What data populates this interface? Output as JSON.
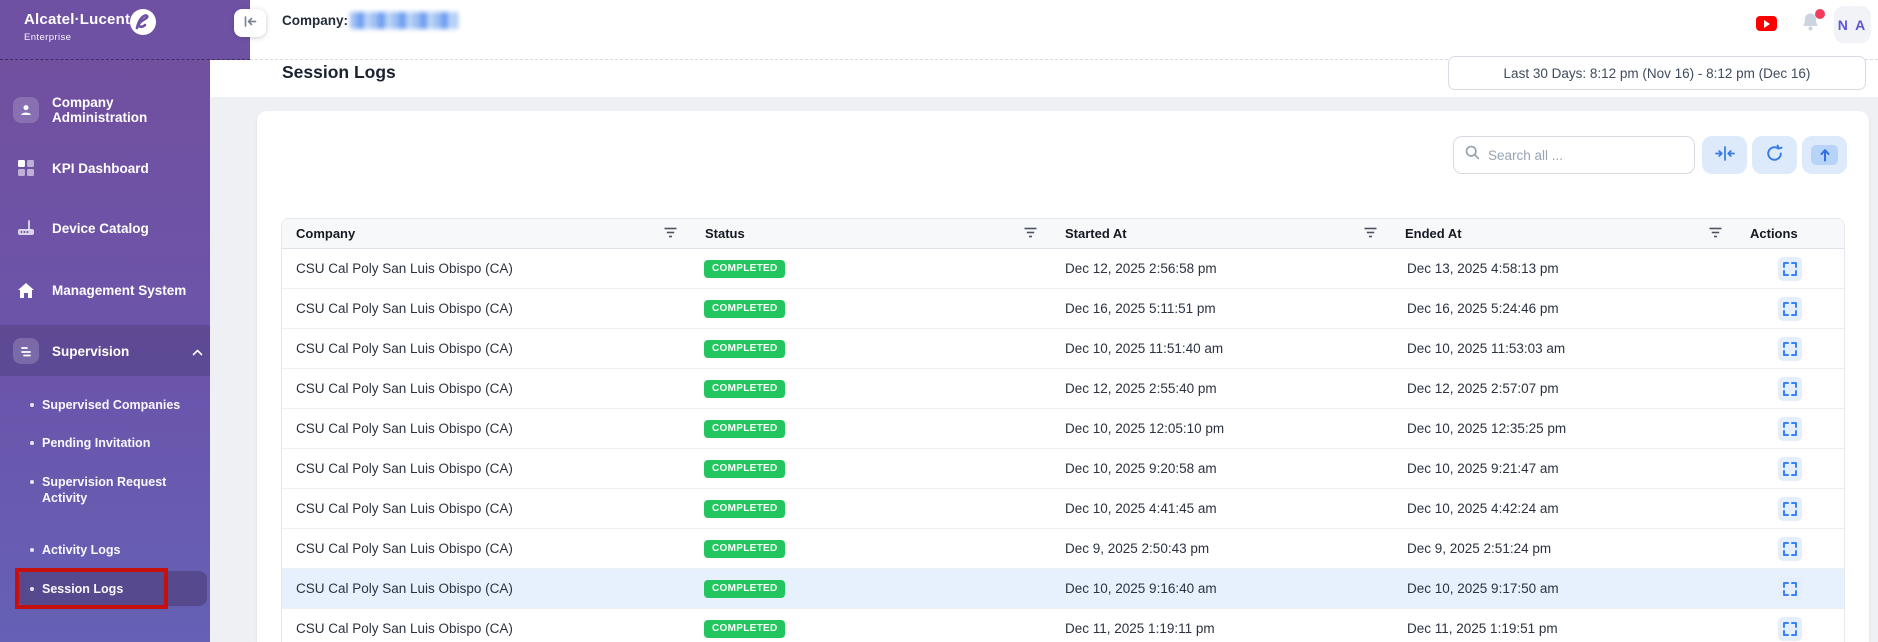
{
  "brand": {
    "name": "Alcatel·Lucent",
    "sub": "Enterprise"
  },
  "topbar": {
    "company_label": "Company:",
    "avatar_initials": "N A"
  },
  "sidebar": {
    "items": [
      {
        "label": "Company Administration",
        "icon": "user-badge-icon"
      },
      {
        "label": "KPI Dashboard",
        "icon": "grid-icon"
      },
      {
        "label": "Device Catalog",
        "icon": "router-icon"
      },
      {
        "label": "Management System",
        "icon": "home-icon"
      },
      {
        "label": "Supervision",
        "icon": "clipboard-list-icon",
        "expanded": true
      }
    ],
    "submenu": [
      "Supervised Companies",
      "Pending Invitation",
      "Supervision Request Activity",
      "Activity Logs",
      "Session Logs"
    ],
    "active_submenu_item": "Session Logs"
  },
  "page": {
    "title": "Session Logs",
    "date_range": "Last 30 Days: 8:12 pm (Nov 16) - 8:12 pm (Dec 16)"
  },
  "toolbar": {
    "search_placeholder": "Search all ..."
  },
  "table": {
    "columns": [
      "Company",
      "Status",
      "Started At",
      "Ended At",
      "Actions"
    ],
    "highlighted_row_index": 8,
    "rows": [
      {
        "company": "CSU Cal Poly San Luis Obispo (CA)",
        "status": "COMPLETED",
        "started_at": "Dec 12, 2025 2:56:58 pm",
        "ended_at": "Dec 13, 2025 4:58:13 pm"
      },
      {
        "company": "CSU Cal Poly San Luis Obispo (CA)",
        "status": "COMPLETED",
        "started_at": "Dec 16, 2025 5:11:51 pm",
        "ended_at": "Dec 16, 2025 5:24:46 pm"
      },
      {
        "company": "CSU Cal Poly San Luis Obispo (CA)",
        "status": "COMPLETED",
        "started_at": "Dec 10, 2025 11:51:40 am",
        "ended_at": "Dec 10, 2025 11:53:03 am"
      },
      {
        "company": "CSU Cal Poly San Luis Obispo (CA)",
        "status": "COMPLETED",
        "started_at": "Dec 12, 2025 2:55:40 pm",
        "ended_at": "Dec 12, 2025 2:57:07 pm"
      },
      {
        "company": "CSU Cal Poly San Luis Obispo (CA)",
        "status": "COMPLETED",
        "started_at": "Dec 10, 2025 12:05:10 pm",
        "ended_at": "Dec 10, 2025 12:35:25 pm"
      },
      {
        "company": "CSU Cal Poly San Luis Obispo (CA)",
        "status": "COMPLETED",
        "started_at": "Dec 10, 2025 9:20:58 am",
        "ended_at": "Dec 10, 2025 9:21:47 am"
      },
      {
        "company": "CSU Cal Poly San Luis Obispo (CA)",
        "status": "COMPLETED",
        "started_at": "Dec 10, 2025 4:41:45 am",
        "ended_at": "Dec 10, 2025 4:42:24 am"
      },
      {
        "company": "CSU Cal Poly San Luis Obispo (CA)",
        "status": "COMPLETED",
        "started_at": "Dec 9, 2025 2:50:43 pm",
        "ended_at": "Dec 9, 2025 2:51:24 pm"
      },
      {
        "company": "CSU Cal Poly San Luis Obispo (CA)",
        "status": "COMPLETED",
        "started_at": "Dec 10, 2025 9:16:40 am",
        "ended_at": "Dec 10, 2025 9:17:50 am"
      },
      {
        "company": "CSU Cal Poly San Luis Obispo (CA)",
        "status": "COMPLETED",
        "started_at": "Dec 11, 2025 1:19:11 pm",
        "ended_at": "Dec 11, 2025 1:19:51 pm"
      }
    ]
  },
  "colors": {
    "sidebar_purple": "#6f51a4",
    "accent_blue": "#3479e8",
    "badge_green": "#22c55e",
    "row_highlight": "#e7f1fd",
    "annotation_red": "#c6100e",
    "youtube_red": "#ff0000"
  }
}
